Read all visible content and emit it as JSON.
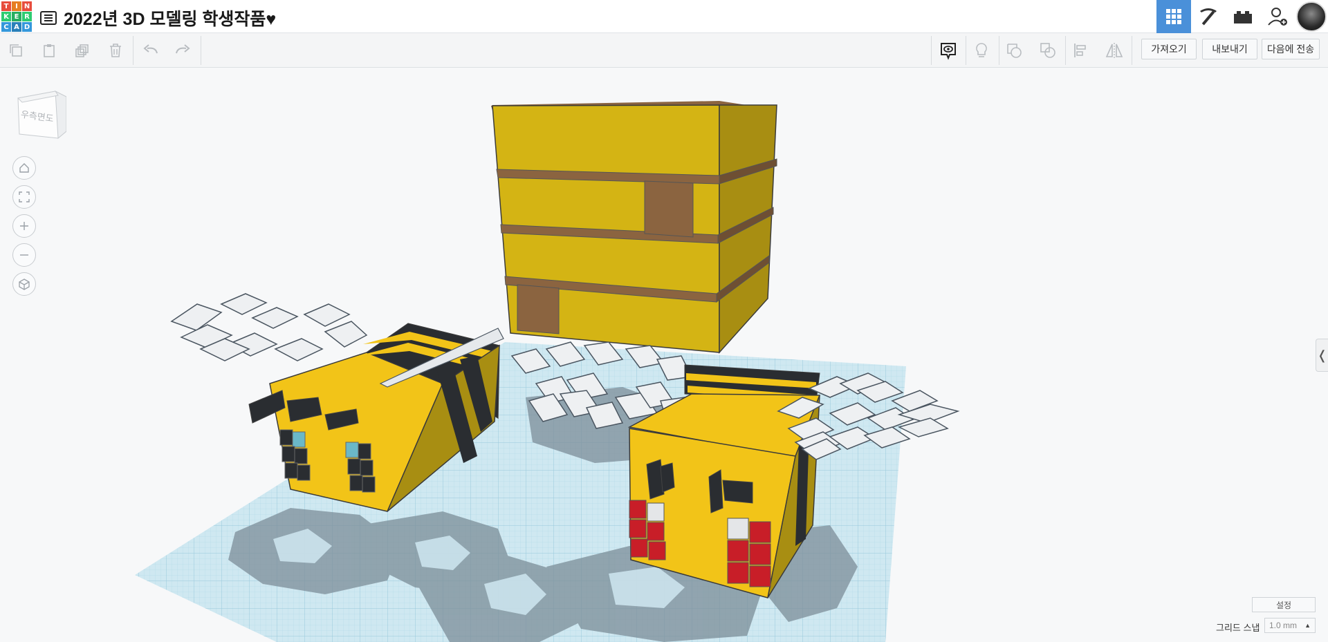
{
  "app": {
    "logo_letters": [
      "T",
      "I",
      "N",
      "K",
      "E",
      "R",
      "C",
      "A",
      "D"
    ],
    "logo_colors": [
      "#e74c3c",
      "#e67e22",
      "#e74c3c",
      "#2ecc71",
      "#27ae60",
      "#2ecc71",
      "#3498db",
      "#2980b9",
      "#3498db"
    ],
    "title": "2022년 3D 모델링 학생작품♥"
  },
  "header_icons": [
    {
      "name": "grid-view-icon",
      "active": true
    },
    {
      "name": "pickaxe-icon",
      "active": false
    },
    {
      "name": "bricks-icon",
      "active": false
    },
    {
      "name": "add-user-icon",
      "active": false
    }
  ],
  "toolbar": {
    "import_label": "가져오기",
    "export_label": "내보내기",
    "send_to_label": "다음에 전송"
  },
  "viewcube": {
    "face_label": "우측면도"
  },
  "bottom": {
    "settings_label": "설정",
    "grid_snap_label": "그리드 스냅",
    "grid_snap_value": "1.0 mm"
  },
  "colors": {
    "accent": "#4a90d9",
    "bee_yellow": "#f2c418",
    "hive_yellow": "#d4b414",
    "hive_brown": "#8b6440",
    "stripe_dark": "#222529",
    "wing_white": "#f0f2f4",
    "eye_red": "#c81e28",
    "grid_blue": "#cfe6ef"
  }
}
